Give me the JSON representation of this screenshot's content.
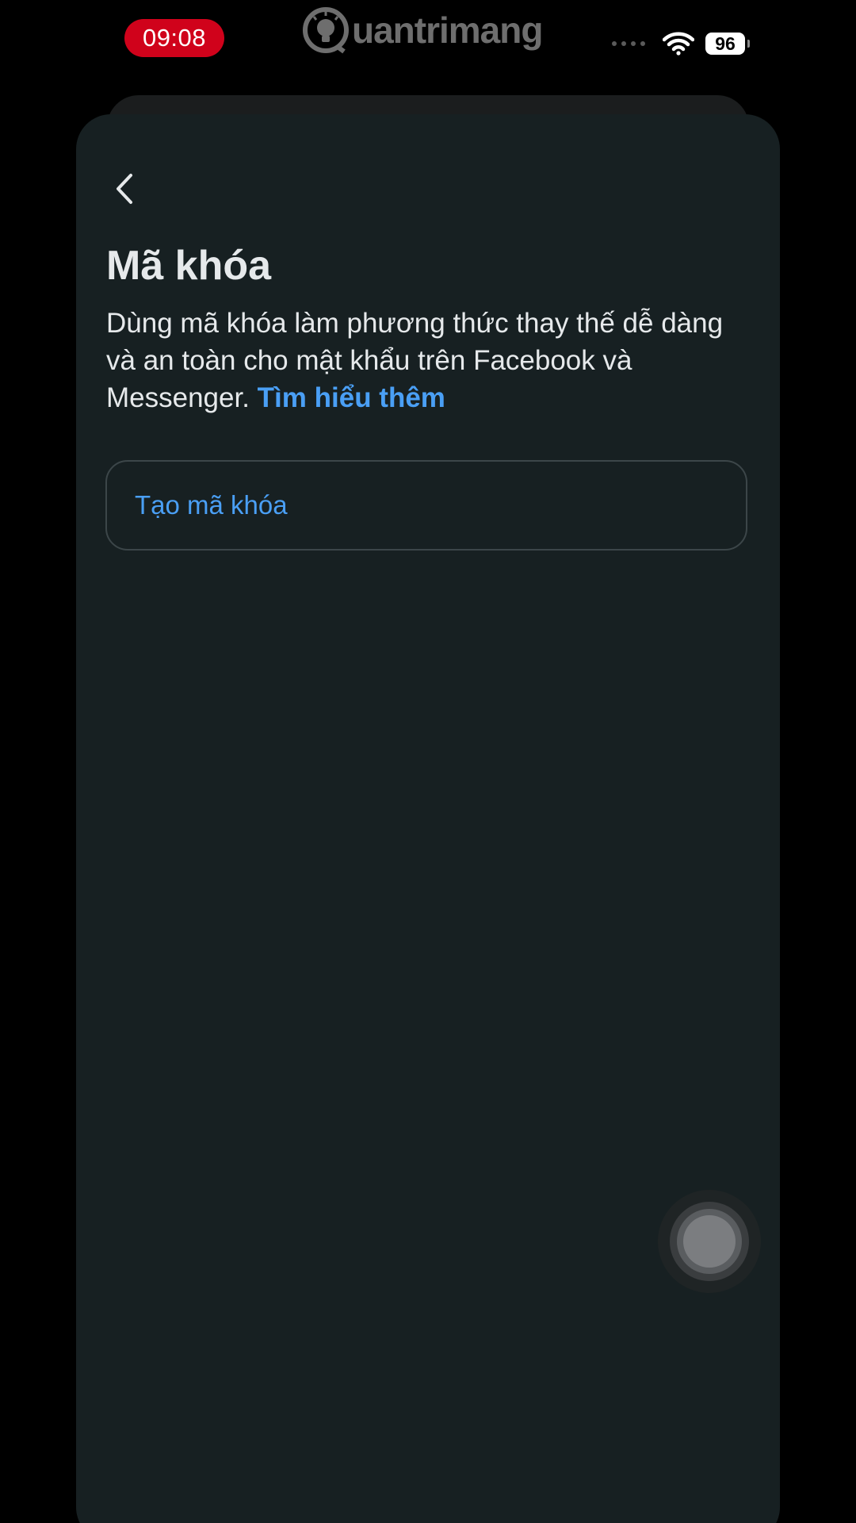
{
  "status_bar": {
    "time": "09:08",
    "battery_level": "96",
    "watermark_text": "uantrimang",
    "time_pill_color": "#d0021b"
  },
  "page": {
    "title": "Mã khóa",
    "description": "Dùng mã khóa làm phương thức thay thế dễ dàng và an toàn cho mật khẩu trên Facebook và Messenger.",
    "learn_more_label": "Tìm hiểu thêm",
    "create_button_label": "Tạo mã khóa"
  },
  "icons": {
    "back": "chevron-left-icon",
    "wifi": "wifi-icon",
    "signal": "signal-icon",
    "battery": "battery-icon",
    "assistive_touch": "assistive-touch-icon",
    "watermark_logo": "lightbulb-logo"
  },
  "colors": {
    "background": "#000000",
    "sheet": "#172022",
    "accent_link": "#4a9ff5",
    "text_primary": "#e6e9eb",
    "button_border": "#3c4649"
  }
}
